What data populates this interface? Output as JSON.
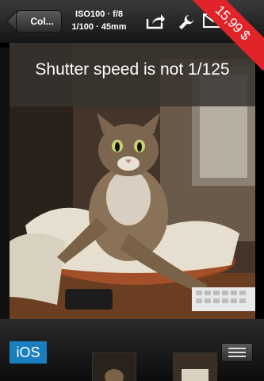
{
  "toolbar": {
    "back_label": "Col...",
    "exif_line1": "ISO100 · f/8",
    "exif_line2": "1/100 · 45mm"
  },
  "price": "15,99 $",
  "photo": {
    "caption": "Shutter speed is not 1/125"
  },
  "badge": "iOS",
  "colors": {
    "price_tag": "#e0242a",
    "ios_badge": "#1a7fbf",
    "toolbar": "#2a2a2a"
  },
  "icons": [
    "share-icon",
    "wrench-icon",
    "mail-icon",
    "menu-icon"
  ]
}
